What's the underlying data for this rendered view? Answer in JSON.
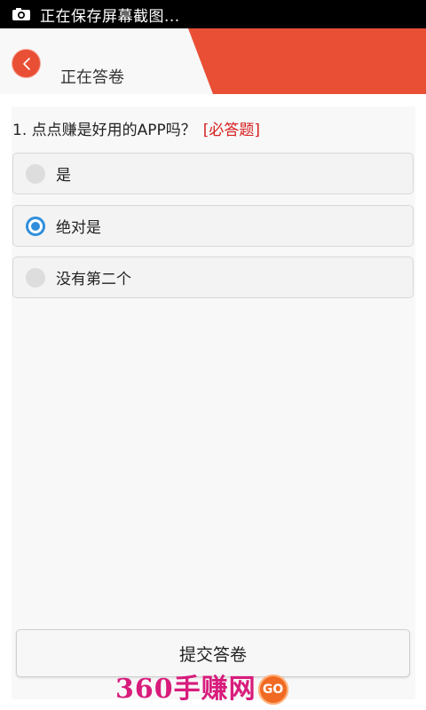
{
  "status_bar": {
    "icon": "screenshot-camera-icon",
    "text": "正在保存屏幕截图..."
  },
  "header": {
    "title": "正在答卷",
    "back_icon": "chevron-left-icon",
    "accent_color": "#e94f35"
  },
  "question": {
    "text": "1. 点点赚是好用的APP吗？",
    "required_label": "[必答题]"
  },
  "options": [
    {
      "label": "是",
      "selected": false
    },
    {
      "label": "绝对是",
      "selected": true
    },
    {
      "label": "没有第二个",
      "selected": false
    }
  ],
  "submit_label": "提交答卷",
  "watermark": {
    "text": "360手赚网",
    "badge": "GO"
  }
}
